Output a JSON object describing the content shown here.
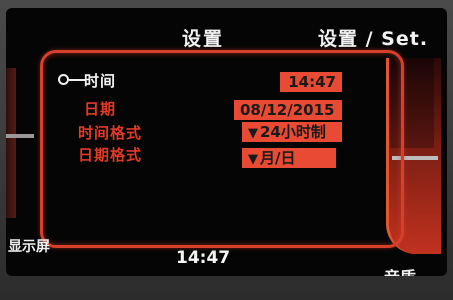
{
  "header": {
    "center_title": "设置",
    "right_title": "设置 / Set."
  },
  "settings": {
    "rows": [
      {
        "label": "时间",
        "value": "14:47",
        "selected": true
      },
      {
        "label": "日期",
        "value": "08/12/2015",
        "selected": false
      },
      {
        "label": "时间格式",
        "value": "24小时制",
        "selected": false
      },
      {
        "label": "日期格式",
        "value": "月/日",
        "selected": false
      }
    ]
  },
  "footer": {
    "left_label": "显示屏",
    "clock": "14:47",
    "right_label": "音质"
  },
  "colors": {
    "accent": "#e23a24",
    "value_box": "#e84a33",
    "background": "#050505"
  }
}
